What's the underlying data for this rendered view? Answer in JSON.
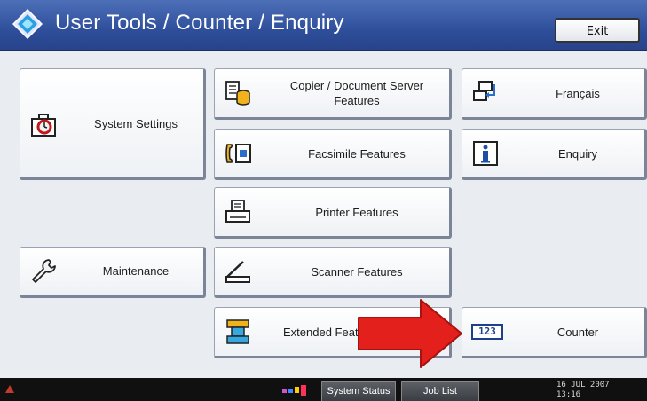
{
  "header": {
    "title": "User Tools / Counter / Enquiry",
    "exit_label": "Exit",
    "icon": "diamond-tools-icon"
  },
  "left_column": {
    "system_settings": {
      "label": "System Settings",
      "icon": "clock-briefcase-icon"
    },
    "maintenance": {
      "label": "Maintenance",
      "icon": "wrench-icon"
    }
  },
  "middle_column": {
    "copier": {
      "label_line1": "Copier / Document Server",
      "label_line2": "Features",
      "icon": "copier-documents-icon"
    },
    "facsimile": {
      "label": "Facsimile Features",
      "icon": "fax-icon"
    },
    "printer": {
      "label": "Printer Features",
      "icon": "printer-icon"
    },
    "scanner": {
      "label": "Scanner Features",
      "icon": "scanner-icon"
    },
    "extended": {
      "label": "Extended Features",
      "icon": "extended-features-icon"
    }
  },
  "right_column": {
    "language": {
      "label": "Français",
      "icon": "language-switch-icon"
    },
    "enquiry": {
      "label": "Enquiry",
      "icon": "info-icon"
    },
    "counter": {
      "label": "Counter",
      "icon": "counter-123-icon",
      "icon_text": "123"
    }
  },
  "status_bar": {
    "system_status_label": "System Status",
    "job_list_label": "Job List",
    "date": "16 JUL  2007",
    "time": "13:16"
  },
  "annotation": {
    "icon": "red-arrow-icon",
    "color": "#e3201b"
  },
  "colors": {
    "title_bar": "#2f4f9b",
    "content_bg": "#e9ecf1",
    "status_bar": "#101010"
  }
}
